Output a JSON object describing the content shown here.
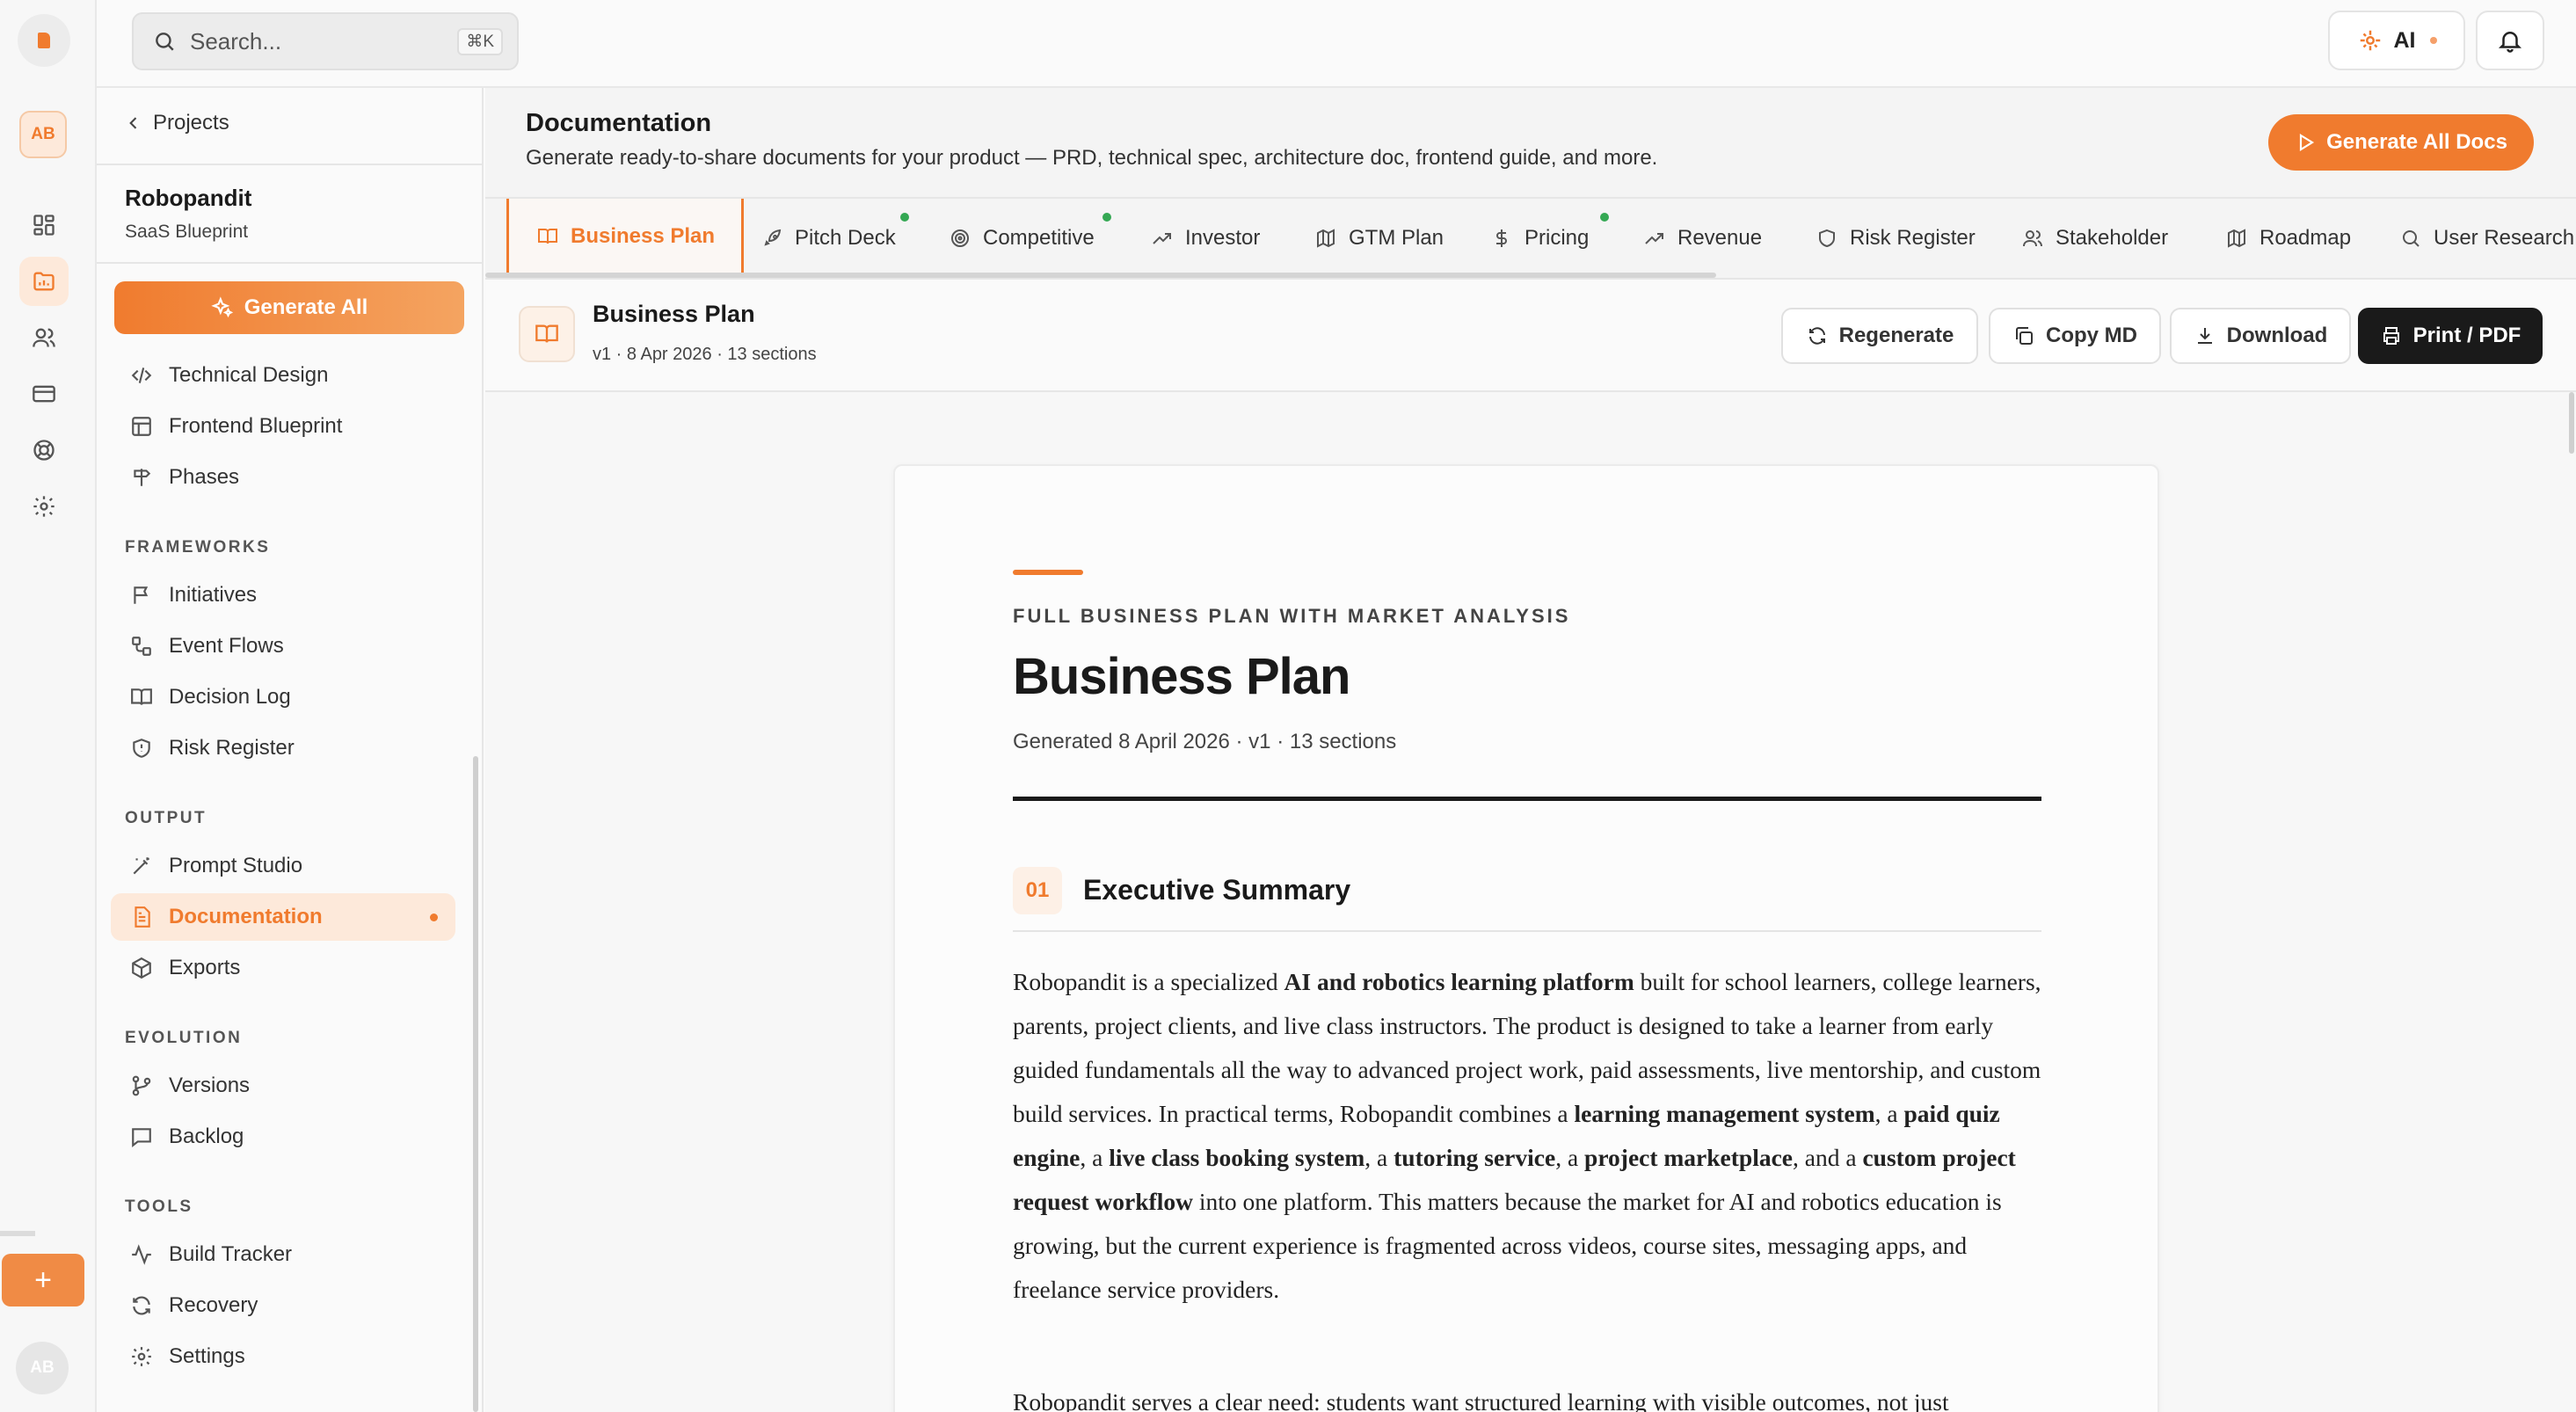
{
  "topbar": {
    "search_placeholder": "Search...",
    "search_shortcut": "⌘K",
    "ai_label": "AI"
  },
  "rail": {
    "top_avatar": "AB",
    "bottom_avatar": "AB",
    "icons": [
      "grid-icon",
      "folder-icon",
      "users-icon",
      "card-icon",
      "lifebuoy-icon",
      "gear-icon"
    ],
    "add_label": "+"
  },
  "sidebar": {
    "back_label": "Projects",
    "project_name": "Robopandit",
    "project_type": "SaaS Blueprint",
    "generate_all": "Generate All",
    "items_top": [
      "Technical Design",
      "Frontend Blueprint",
      "Phases"
    ],
    "sections": {
      "frameworks": "FRAMEWORKS",
      "output": "OUTPUT",
      "evolution": "EVOLUTION",
      "tools": "TOOLS"
    },
    "frameworks": [
      "Initiatives",
      "Event Flows",
      "Decision Log",
      "Risk Register"
    ],
    "output": [
      "Prompt Studio",
      "Documentation",
      "Exports"
    ],
    "evolution": [
      "Versions",
      "Backlog"
    ],
    "tools": [
      "Build Tracker",
      "Recovery",
      "Settings"
    ]
  },
  "header": {
    "title": "Documentation",
    "subtitle": "Generate ready-to-share documents for your product — PRD, technical spec, architecture doc, frontend guide, and more.",
    "generate_all_docs": "Generate All Docs"
  },
  "tabs": [
    "Business Plan",
    "Pitch Deck",
    "Competitive",
    "Investor",
    "GTM Plan",
    "Pricing",
    "Revenue",
    "Risk Register",
    "Stakeholder",
    "Roadmap",
    "User Research"
  ],
  "doc": {
    "name": "Business Plan",
    "meta": "v1 · 8 Apr 2026 · 13 sections",
    "actions": {
      "regenerate": "Regenerate",
      "copy_md": "Copy MD",
      "download": "Download",
      "print": "Print / PDF"
    }
  },
  "paper": {
    "kicker": "FULL BUSINESS PLAN WITH MARKET ANALYSIS",
    "title": "Business Plan",
    "meta": "Generated 8 April 2026 · v1 · 13 sections",
    "section_num": "01",
    "section_title": "Executive Summary",
    "p1": [
      {
        "t": "Robopandit is a specialized ",
        "b": false
      },
      {
        "t": "AI and robotics learning platform",
        "b": true
      },
      {
        "t": " built for school learners, college learners, parents, project clients, and live class instructors. The product is designed to take a learner from early guided fundamentals all the way to advanced project work, paid assessments, live mentorship, and custom build services. In practical terms, Robopandit combines a ",
        "b": false
      },
      {
        "t": "learning management system",
        "b": true
      },
      {
        "t": ", a ",
        "b": false
      },
      {
        "t": "paid quiz engine",
        "b": true
      },
      {
        "t": ", a ",
        "b": false
      },
      {
        "t": "live class booking system",
        "b": true
      },
      {
        "t": ", a ",
        "b": false
      },
      {
        "t": "tutoring service",
        "b": true
      },
      {
        "t": ", a ",
        "b": false
      },
      {
        "t": "project marketplace",
        "b": true
      },
      {
        "t": ", and a ",
        "b": false
      },
      {
        "t": "custom project request workflow",
        "b": true
      },
      {
        "t": " into one platform. This matters because the market for AI and robotics education is growing, but the current experience is fragmented across videos, course sites, messaging apps, and freelance service providers.",
        "b": false
      }
    ],
    "p2": "Robopandit serves a clear need: students want structured learning with visible outcomes, not just"
  },
  "colors": {
    "accent": "#f07b2e",
    "accent_soft": "#fde9da",
    "dark": "#1a1a1a",
    "green": "#34a853"
  }
}
